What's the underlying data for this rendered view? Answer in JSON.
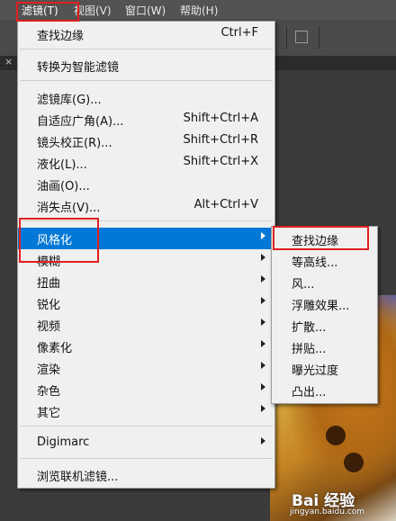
{
  "menubar": {
    "items": [
      {
        "label": "滤镜(T)"
      },
      {
        "label": "视图(V)"
      },
      {
        "label": "窗口(W)"
      },
      {
        "label": "帮助(H)"
      }
    ]
  },
  "filter_menu": {
    "items": [
      {
        "label": "查找边缘",
        "shortcut": "Ctrl+F"
      },
      {
        "label": "转换为智能滤镜",
        "shortcut": ""
      },
      {
        "label": "滤镜库(G)...",
        "shortcut": ""
      },
      {
        "label": "自适应广角(A)...",
        "shortcut": "Shift+Ctrl+A"
      },
      {
        "label": "镜头校正(R)...",
        "shortcut": "Shift+Ctrl+R"
      },
      {
        "label": "液化(L)...",
        "shortcut": "Shift+Ctrl+X"
      },
      {
        "label": "油画(O)...",
        "shortcut": ""
      },
      {
        "label": "消失点(V)...",
        "shortcut": "Alt+Ctrl+V"
      },
      {
        "label": "风格化"
      },
      {
        "label": "模糊"
      },
      {
        "label": "扭曲"
      },
      {
        "label": "锐化"
      },
      {
        "label": "视频"
      },
      {
        "label": "像素化"
      },
      {
        "label": "渲染"
      },
      {
        "label": "杂色"
      },
      {
        "label": "其它"
      },
      {
        "label": "Digimarc"
      },
      {
        "label": "浏览联机滤镜..."
      }
    ]
  },
  "stylize_submenu": {
    "items": [
      {
        "label": "查找边缘"
      },
      {
        "label": "等高线..."
      },
      {
        "label": "风..."
      },
      {
        "label": "浮雕效果..."
      },
      {
        "label": "扩散..."
      },
      {
        "label": "拼贴..."
      },
      {
        "label": "曝光过度"
      },
      {
        "label": "凸出..."
      }
    ]
  },
  "watermark": {
    "logo": "Bai 经验",
    "url": "jingyan.baidu.com"
  },
  "colors": {
    "highlight": "#0078d7",
    "annotation": "#e02020",
    "menu_bg": "#f0f0f0"
  }
}
